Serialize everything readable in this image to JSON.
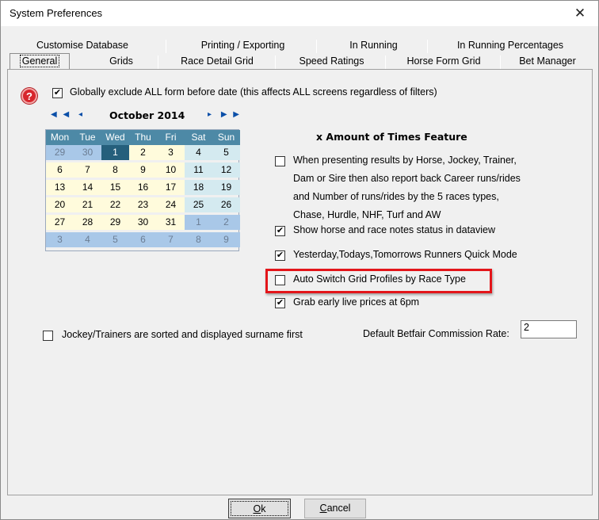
{
  "window": {
    "title": "System Preferences",
    "close_symbol": "✕"
  },
  "tabs": {
    "row1": [
      "Customise Database",
      "Printing / Exporting",
      "In Running",
      "In Running Percentages"
    ],
    "row2": [
      "General",
      "Grids",
      "Race Detail Grid",
      "Speed Ratings",
      "Horse Form Grid",
      "Bet Manager"
    ],
    "active": "General"
  },
  "general": {
    "help_icon": "question-icon",
    "help_glyph": "?",
    "exclude_form": {
      "label": "Globally exclude ALL form before date (this affects ALL screens regardless of filters)",
      "checked": true
    },
    "calendar": {
      "nav_prev": [
        "◀",
        "◀",
        "◂"
      ],
      "nav_next": [
        "▸",
        "▶",
        "▶"
      ],
      "month": "October 2014",
      "weekdays": [
        "Mon",
        "Tue",
        "Wed",
        "Thu",
        "Fri",
        "Sat",
        "Sun"
      ],
      "weeks": [
        [
          "29",
          "30",
          "1",
          "2",
          "3",
          "4",
          "5"
        ],
        [
          "6",
          "7",
          "8",
          "9",
          "10",
          "11",
          "12"
        ],
        [
          "13",
          "14",
          "15",
          "16",
          "17",
          "18",
          "19"
        ],
        [
          "20",
          "21",
          "22",
          "23",
          "24",
          "25",
          "26"
        ],
        [
          "27",
          "28",
          "29",
          "30",
          "31",
          "1",
          "2"
        ],
        [
          "3",
          "4",
          "5",
          "6",
          "7",
          "8",
          "9"
        ]
      ],
      "selected_day": "1"
    },
    "times_feature": {
      "title": "x Amount of Times Feature",
      "career_runs": {
        "lines": [
          "When presenting results by Horse, Jockey, Trainer,",
          "Dam or Sire then also report back Career runs/rides",
          "and Number of runs/rides by the 5 races types,",
          "Chase, Hurdle, NHF, Turf and AW"
        ],
        "checked": false
      }
    },
    "show_notes": {
      "label": "Show horse and race notes status in dataview",
      "checked": true
    },
    "quick_mode": {
      "label": "Yesterday,Todays,Tomorrows Runners Quick Mode",
      "checked": true
    },
    "auto_switch": {
      "label": "Auto Switch Grid Profiles by Race Type",
      "checked": false
    },
    "early_prices": {
      "label": "Grab early live prices at 6pm",
      "checked": true
    },
    "surname_first": {
      "label": "Jockey/Trainers are sorted and displayed surname first",
      "checked": false
    },
    "betfair_rate": {
      "label": "Default Betfair Commission Rate:",
      "value": "2"
    }
  },
  "buttons": {
    "ok": {
      "accel": "O",
      "rest": "k"
    },
    "cancel": {
      "accel": "C",
      "rest": "ancel"
    }
  },
  "colors": {
    "highlight": "#e3151a",
    "calendar_header": "#4d89a6",
    "calendar_selected": "#255f7c"
  }
}
